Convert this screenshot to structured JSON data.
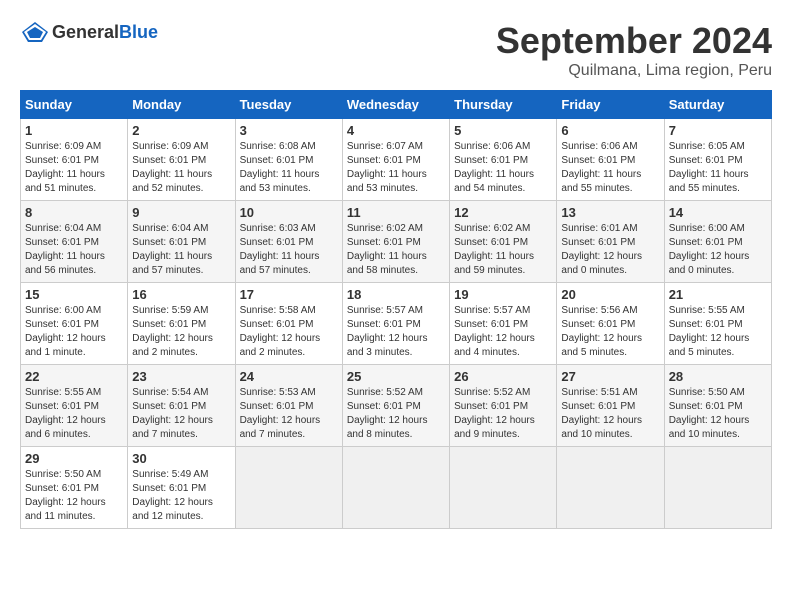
{
  "header": {
    "logo_general": "General",
    "logo_blue": "Blue",
    "title": "September 2024",
    "subtitle": "Quilmana, Lima region, Peru"
  },
  "calendar": {
    "days_of_week": [
      "Sunday",
      "Monday",
      "Tuesday",
      "Wednesday",
      "Thursday",
      "Friday",
      "Saturday"
    ],
    "weeks": [
      [
        {
          "day": "",
          "empty": true
        },
        {
          "day": "",
          "empty": true
        },
        {
          "day": "",
          "empty": true
        },
        {
          "day": "",
          "empty": true
        },
        {
          "day": "",
          "empty": true
        },
        {
          "day": "",
          "empty": true
        },
        {
          "day": "",
          "empty": true
        }
      ]
    ],
    "cells": [
      {
        "date": 1,
        "sunrise": "6:09 AM",
        "sunset": "6:01 PM",
        "daylight": "11 hours and 51 minutes."
      },
      {
        "date": 2,
        "sunrise": "6:09 AM",
        "sunset": "6:01 PM",
        "daylight": "11 hours and 52 minutes."
      },
      {
        "date": 3,
        "sunrise": "6:08 AM",
        "sunset": "6:01 PM",
        "daylight": "11 hours and 53 minutes."
      },
      {
        "date": 4,
        "sunrise": "6:07 AM",
        "sunset": "6:01 PM",
        "daylight": "11 hours and 53 minutes."
      },
      {
        "date": 5,
        "sunrise": "6:06 AM",
        "sunset": "6:01 PM",
        "daylight": "11 hours and 54 minutes."
      },
      {
        "date": 6,
        "sunrise": "6:06 AM",
        "sunset": "6:01 PM",
        "daylight": "11 hours and 55 minutes."
      },
      {
        "date": 7,
        "sunrise": "6:05 AM",
        "sunset": "6:01 PM",
        "daylight": "11 hours and 55 minutes."
      },
      {
        "date": 8,
        "sunrise": "6:04 AM",
        "sunset": "6:01 PM",
        "daylight": "11 hours and 56 minutes."
      },
      {
        "date": 9,
        "sunrise": "6:04 AM",
        "sunset": "6:01 PM",
        "daylight": "11 hours and 57 minutes."
      },
      {
        "date": 10,
        "sunrise": "6:03 AM",
        "sunset": "6:01 PM",
        "daylight": "11 hours and 57 minutes."
      },
      {
        "date": 11,
        "sunrise": "6:02 AM",
        "sunset": "6:01 PM",
        "daylight": "11 hours and 58 minutes."
      },
      {
        "date": 12,
        "sunrise": "6:02 AM",
        "sunset": "6:01 PM",
        "daylight": "11 hours and 59 minutes."
      },
      {
        "date": 13,
        "sunrise": "6:01 AM",
        "sunset": "6:01 PM",
        "daylight": "12 hours and 0 minutes."
      },
      {
        "date": 14,
        "sunrise": "6:00 AM",
        "sunset": "6:01 PM",
        "daylight": "12 hours and 0 minutes."
      },
      {
        "date": 15,
        "sunrise": "6:00 AM",
        "sunset": "6:01 PM",
        "daylight": "12 hours and 1 minute."
      },
      {
        "date": 16,
        "sunrise": "5:59 AM",
        "sunset": "6:01 PM",
        "daylight": "12 hours and 2 minutes."
      },
      {
        "date": 17,
        "sunrise": "5:58 AM",
        "sunset": "6:01 PM",
        "daylight": "12 hours and 2 minutes."
      },
      {
        "date": 18,
        "sunrise": "5:57 AM",
        "sunset": "6:01 PM",
        "daylight": "12 hours and 3 minutes."
      },
      {
        "date": 19,
        "sunrise": "5:57 AM",
        "sunset": "6:01 PM",
        "daylight": "12 hours and 4 minutes."
      },
      {
        "date": 20,
        "sunrise": "5:56 AM",
        "sunset": "6:01 PM",
        "daylight": "12 hours and 5 minutes."
      },
      {
        "date": 21,
        "sunrise": "5:55 AM",
        "sunset": "6:01 PM",
        "daylight": "12 hours and 5 minutes."
      },
      {
        "date": 22,
        "sunrise": "5:55 AM",
        "sunset": "6:01 PM",
        "daylight": "12 hours and 6 minutes."
      },
      {
        "date": 23,
        "sunrise": "5:54 AM",
        "sunset": "6:01 PM",
        "daylight": "12 hours and 7 minutes."
      },
      {
        "date": 24,
        "sunrise": "5:53 AM",
        "sunset": "6:01 PM",
        "daylight": "12 hours and 7 minutes."
      },
      {
        "date": 25,
        "sunrise": "5:52 AM",
        "sunset": "6:01 PM",
        "daylight": "12 hours and 8 minutes."
      },
      {
        "date": 26,
        "sunrise": "5:52 AM",
        "sunset": "6:01 PM",
        "daylight": "12 hours and 9 minutes."
      },
      {
        "date": 27,
        "sunrise": "5:51 AM",
        "sunset": "6:01 PM",
        "daylight": "12 hours and 10 minutes."
      },
      {
        "date": 28,
        "sunrise": "5:50 AM",
        "sunset": "6:01 PM",
        "daylight": "12 hours and 10 minutes."
      },
      {
        "date": 29,
        "sunrise": "5:50 AM",
        "sunset": "6:01 PM",
        "daylight": "12 hours and 11 minutes."
      },
      {
        "date": 30,
        "sunrise": "5:49 AM",
        "sunset": "6:01 PM",
        "daylight": "12 hours and 12 minutes."
      }
    ]
  }
}
